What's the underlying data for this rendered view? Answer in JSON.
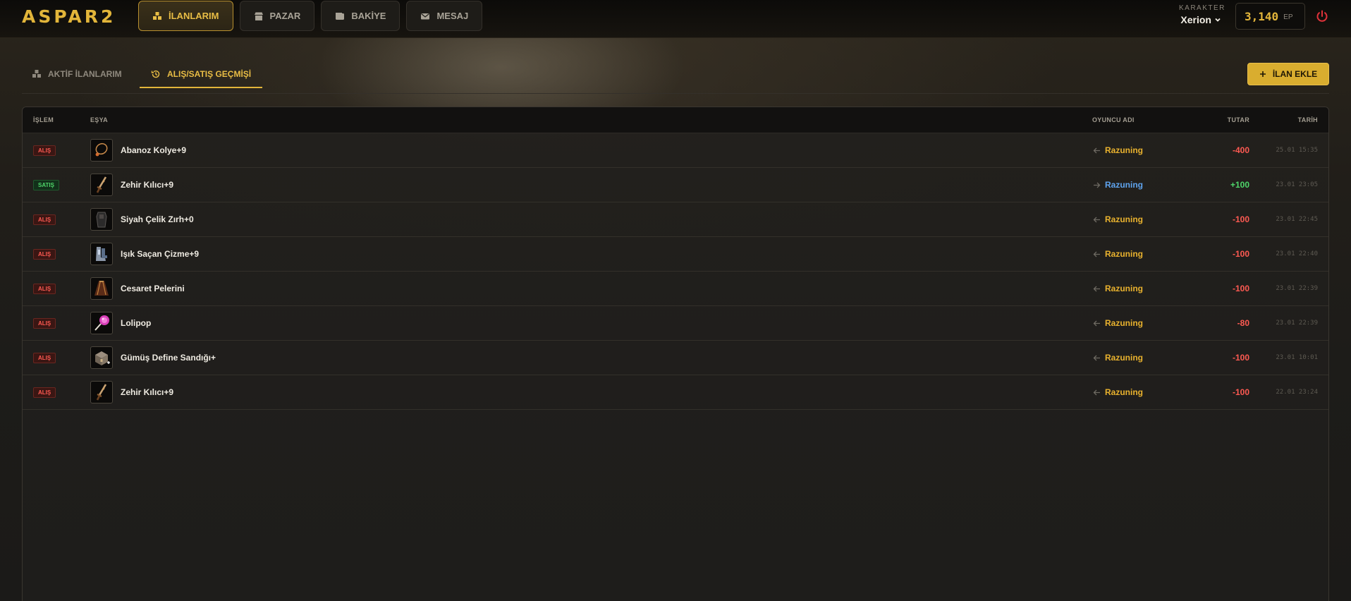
{
  "app": {
    "logo": "ASPAR2"
  },
  "nav": [
    {
      "label": "İLANLARIM",
      "icon": "boxes-icon",
      "active": true
    },
    {
      "label": "PAZAR",
      "icon": "store-icon",
      "active": false
    },
    {
      "label": "BAKİYE",
      "icon": "wallet-icon",
      "active": false
    },
    {
      "label": "MESAJ",
      "icon": "envelope-icon",
      "active": false
    }
  ],
  "character": {
    "label": "KARAKTER",
    "name": "Xerion"
  },
  "balance": {
    "value": "3,140",
    "unit": "EP"
  },
  "tabs": [
    {
      "label": "AKTİF İLANLARIM",
      "icon": "boxes-icon",
      "active": false
    },
    {
      "label": "ALIŞ/SATIŞ GEÇMİŞİ",
      "icon": "history-icon",
      "active": true
    }
  ],
  "add_button": {
    "label": "İLAN EKLE"
  },
  "table": {
    "headers": {
      "type": "İŞLEM",
      "item": "EŞYA",
      "player": "OYUNCU ADI",
      "amount": "TUTAR",
      "date": "TARİH"
    },
    "rows": [
      {
        "type": "ALIŞ",
        "item": "Abanoz Kolye+9",
        "icon": "necklace-icon",
        "player": "Razuning",
        "amount": "-400",
        "date": "25.01 15:35"
      },
      {
        "type": "SATIŞ",
        "item": "Zehir Kılıcı+9",
        "icon": "sword-icon",
        "player": "Razuning",
        "amount": "+100",
        "date": "23.01 23:05"
      },
      {
        "type": "ALIŞ",
        "item": "Siyah Çelik Zırh+0",
        "icon": "armor-icon",
        "player": "Razuning",
        "amount": "-100",
        "date": "23.01 22:45"
      },
      {
        "type": "ALIŞ",
        "item": "Işık Saçan Çizme+9",
        "icon": "boots-icon",
        "player": "Razuning",
        "amount": "-100",
        "date": "23.01 22:40"
      },
      {
        "type": "ALIŞ",
        "item": "Cesaret Pelerini",
        "icon": "cape-icon",
        "player": "Razuning",
        "amount": "-100",
        "date": "23.01 22:39"
      },
      {
        "type": "ALIŞ",
        "item": "Lolipop",
        "icon": "lollipop-icon",
        "player": "Razuning",
        "amount": "-80",
        "date": "23.01 22:39"
      },
      {
        "type": "ALIŞ",
        "item": "Gümüş Define Sandığı+",
        "icon": "chest-icon",
        "player": "Razuning",
        "amount": "-100",
        "date": "23.01 10:01"
      },
      {
        "type": "ALIŞ",
        "item": "Zehir Kılıcı+9",
        "icon": "sword-icon",
        "player": "Razuning",
        "amount": "-100",
        "date": "22.01 23:24"
      }
    ]
  },
  "colors": {
    "accent": "#e2b53a",
    "buy": "#ff5a52",
    "sell": "#4fd66a",
    "player_buy": "#e9b22e",
    "player_sell": "#5fa4ee"
  }
}
